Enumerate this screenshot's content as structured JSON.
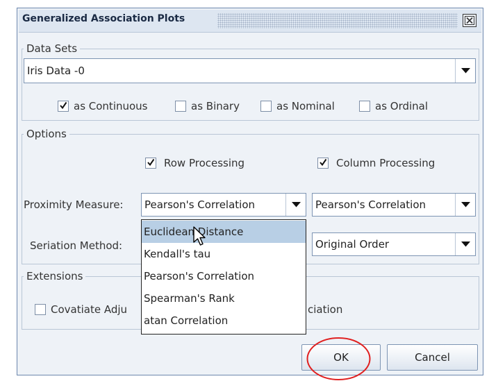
{
  "dialog": {
    "title": "Generalized Association Plots"
  },
  "data_sets": {
    "group_label": "Data Sets",
    "selected": "Iris Data -0",
    "checkboxes": [
      {
        "label": "as Continuous",
        "checked": true
      },
      {
        "label": "as Binary",
        "checked": false
      },
      {
        "label": "as Nominal",
        "checked": false
      },
      {
        "label": "as Ordinal",
        "checked": false
      }
    ]
  },
  "options": {
    "group_label": "Options",
    "row_processing": {
      "label": "Row Processing",
      "checked": true
    },
    "column_processing": {
      "label": "Column Processing",
      "checked": true
    },
    "proximity_label": "Proximity Measure:",
    "proximity_row_value": "Pearson's Correlation",
    "proximity_col_value": "Pearson's Correlation",
    "seriation_label": "Seriation Method:",
    "seriation_col_value": "Original Order"
  },
  "dropdown": {
    "items": [
      "Euclidean Distance",
      "Kendall's tau",
      "Pearson's Correlation",
      "Spearman's Rank",
      "atan Correlation"
    ],
    "selected_index": 0
  },
  "extensions": {
    "group_label": "Extensions",
    "covariate_label": "Covatiate Adju",
    "association_tail": "ciation"
  },
  "buttons": {
    "ok": "OK",
    "cancel": "Cancel"
  },
  "colors": {
    "annotation_circle": "#e02020",
    "selection": "#b8cfe5"
  }
}
